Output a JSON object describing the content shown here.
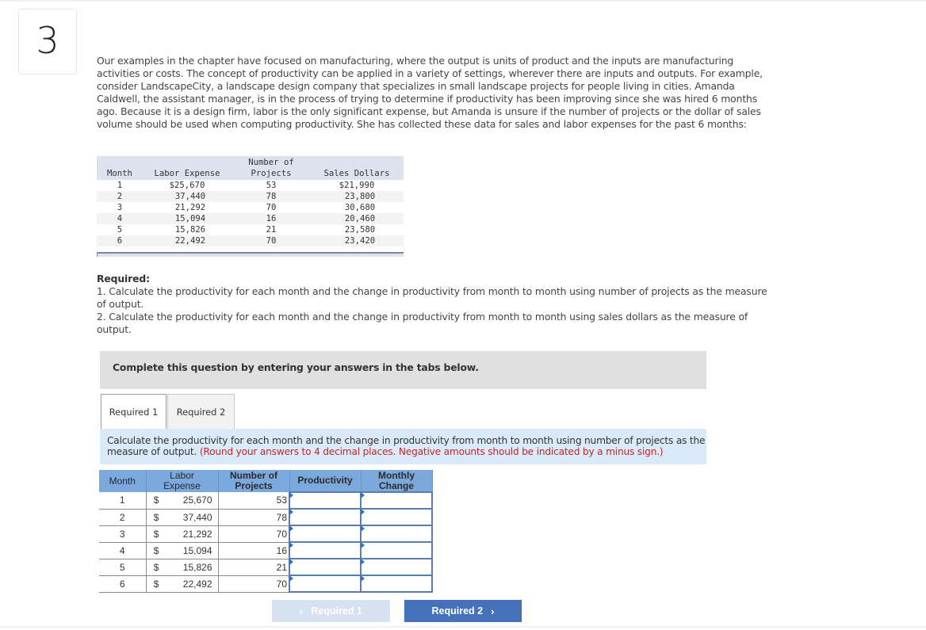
{
  "question_number": "3",
  "intro_text": "Our examples in the chapter have focused on manufacturing, where the output is units of product and the inputs are manufacturing activities or costs. The concept of productivity can be applied in a variety of settings, wherever there are inputs and outputs. For example, consider LandscapeCity, a landscape design company that specializes in small landscape projects for people living in cities. Amanda Caldwell, the assistant manager, is in the process of trying to determine if productivity has been improving since she was hired 6 months ago. Because it is a design firm, labor is the only significant expense, but Amanda is unsure if the number of projects or the dollar of sales volume should be used when computing productivity. She has collected these data for sales and labor expenses for the past 6 months:",
  "data_table": {
    "headers": {
      "month": "Month",
      "labor_expense": "Labor Expense",
      "projects_line1": "Number of",
      "projects_line2": "Projects",
      "sales_dollars": "Sales Dollars"
    },
    "rows": [
      {
        "month": "1",
        "labor_expense": "$25,670",
        "projects": "53",
        "sales_dollars": "$21,990"
      },
      {
        "month": "2",
        "labor_expense": "37,440",
        "projects": "78",
        "sales_dollars": "23,800"
      },
      {
        "month": "3",
        "labor_expense": "21,292",
        "projects": "70",
        "sales_dollars": "30,680"
      },
      {
        "month": "4",
        "labor_expense": "15,094",
        "projects": "16",
        "sales_dollars": "20,460"
      },
      {
        "month": "5",
        "labor_expense": "15,826",
        "projects": "21",
        "sales_dollars": "23,580"
      },
      {
        "month": "6",
        "labor_expense": "22,492",
        "projects": "70",
        "sales_dollars": "23,420"
      }
    ]
  },
  "required": {
    "title": "Required:",
    "item1": "1. Calculate the productivity for each month and the change in productivity from month to month using number of projects as the measure of output.",
    "item2": "2. Calculate the productivity for each month and the change in productivity from month to month using sales dollars as the measure of output."
  },
  "complete_instruction": "Complete this question by entering your answers in the tabs below.",
  "tabs": [
    {
      "label": "Required 1",
      "active": true
    },
    {
      "label": "Required 2",
      "active": false
    }
  ],
  "instruction": {
    "main": "Calculate the productivity for each month and the change in productivity from month to month using number of projects as the measure of output.",
    "note": "(Round your answers to 4 decimal places. Negative amounts should be indicated by a minus sign.)"
  },
  "answer_table": {
    "headers": {
      "month": "Month",
      "labor_line1": "Labor",
      "labor_line2": "Expense",
      "projects_line1": "Number of",
      "projects_line2": "Projects",
      "productivity": "Productivity",
      "change_line1": "Monthly",
      "change_line2": "Change"
    },
    "currency_symbol": "$",
    "rows": [
      {
        "month": "1",
        "labor_expense": "25,670",
        "projects": "53",
        "productivity": "",
        "monthly_change": ""
      },
      {
        "month": "2",
        "labor_expense": "37,440",
        "projects": "78",
        "productivity": "",
        "monthly_change": ""
      },
      {
        "month": "3",
        "labor_expense": "21,292",
        "projects": "70",
        "productivity": "",
        "monthly_change": ""
      },
      {
        "month": "4",
        "labor_expense": "15,094",
        "projects": "16",
        "productivity": "",
        "monthly_change": ""
      },
      {
        "month": "5",
        "labor_expense": "15,826",
        "projects": "21",
        "productivity": "",
        "monthly_change": ""
      },
      {
        "month": "6",
        "labor_expense": "22,492",
        "projects": "70",
        "productivity": "",
        "monthly_change": ""
      }
    ]
  },
  "navigation": {
    "prev_label": "Required 1",
    "next_label": "Required 2",
    "prev_icon": "‹",
    "next_icon": "›"
  },
  "colors": {
    "header_blue": "#7ba9de",
    "instruction_bg": "#dbeaf8",
    "note_red": "#c0282d",
    "next_button": "#4471b8",
    "prev_button_disabled": "#d6e2f0"
  }
}
